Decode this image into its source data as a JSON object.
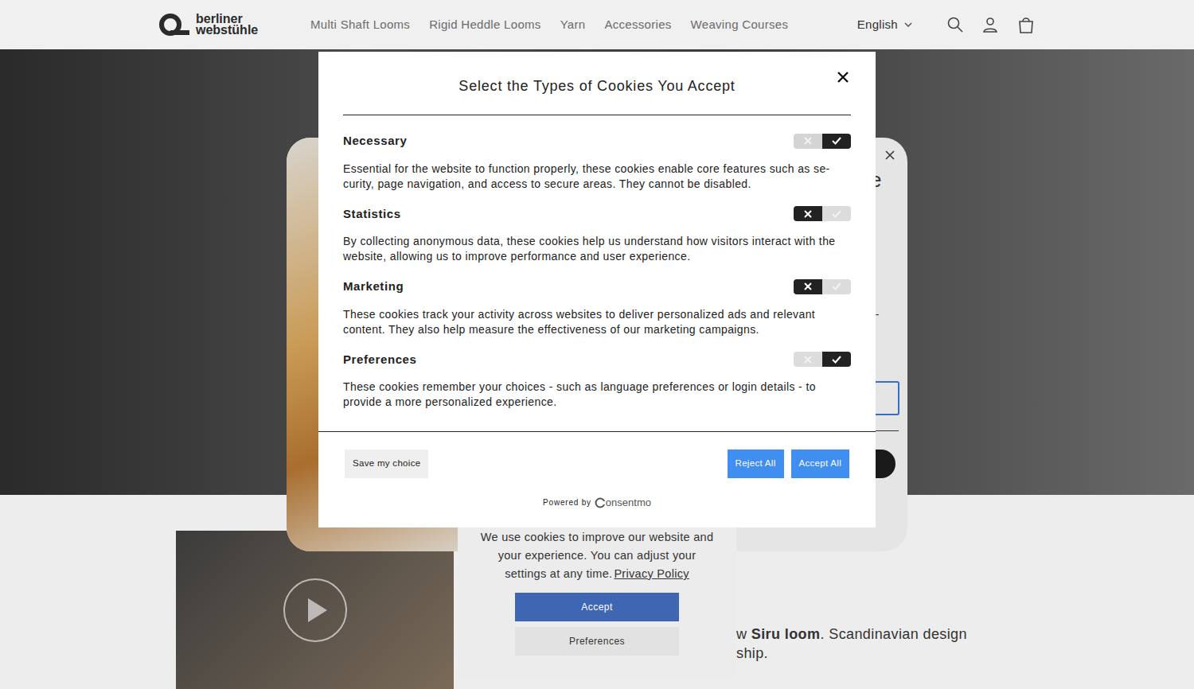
{
  "header": {
    "logo": [
      "berliner",
      "webstühle"
    ],
    "nav": [
      "Multi Shaft Looms",
      "Rigid Heddle Looms",
      "Yarn",
      "Accessories",
      "Weaving Courses"
    ],
    "language": "English"
  },
  "popup": {
    "fragments": [
      "e",
      "r-"
    ]
  },
  "cookie_modal": {
    "title": "Select the Types of Cookies You Accept",
    "categories": [
      {
        "name": "Necessary",
        "description": "Essential for the website to function properly, these cookies enable core features such as se-curity, page navigation, and access to secure areas. They cannot be disabled.",
        "enabled": true,
        "locked": true
      },
      {
        "name": "Statistics",
        "description": "By collecting anonymous data, these cookies help us understand how visitors interact with the website, allowing us to improve performance and user experience.",
        "enabled": false,
        "locked": false
      },
      {
        "name": "Marketing",
        "description": "These cookies track your activity across websites to deliver personalized ads and relevant content. They also help measure the effectiveness of our marketing campaigns.",
        "enabled": false,
        "locked": false
      },
      {
        "name": "Preferences",
        "description": "These cookies remember your choices - such as language preferences or login details - to provide a more personalized experience.",
        "enabled": true,
        "locked": false
      }
    ],
    "buttons": {
      "save": "Save my choice",
      "reject": "Reject All",
      "accept": "Accept All"
    },
    "powered_by": "Powered by",
    "brand": "onsentmo"
  },
  "banner": {
    "text": "We use cookies to improve our website and your experience. You can adjust your settings at any time.",
    "link": "Privacy Policy",
    "accept": "Accept",
    "preferences": "Preferences"
  },
  "section": {
    "before": "w ",
    "bold": "Siru loom",
    "after": ". Scandinavian design",
    "line2": "ship."
  }
}
